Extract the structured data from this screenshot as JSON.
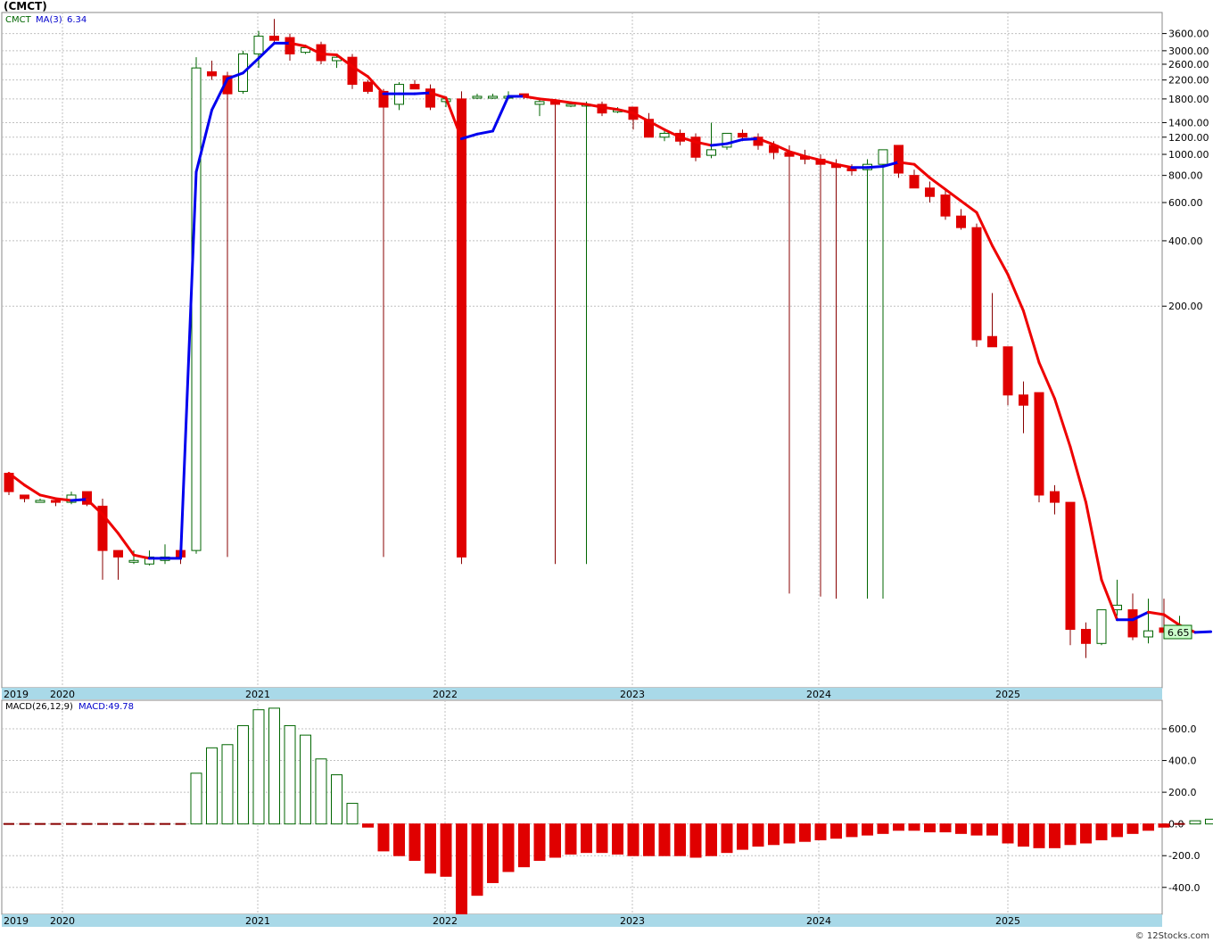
{
  "title": "(CMCT)",
  "credit": "© 12Stocks.com",
  "price_panel": {
    "legend": {
      "symbol": "CMCT",
      "ma_label": "MA(3)",
      "ma_value": "6.34"
    },
    "last_price": "6.65",
    "y_ticks": [
      "3600.00",
      "3000.00",
      "2600.00",
      "2200.00",
      "1800.00",
      "1400.00",
      "1200.00",
      "1000.00",
      "800.00",
      "600.00",
      "400.00",
      "200.00"
    ]
  },
  "macd_panel": {
    "legend": {
      "label": "MACD(26,12,9)",
      "value_label": "MACD:49.78"
    },
    "y_ticks": [
      "600.0",
      "400.0",
      "200.0",
      "0.0",
      "-200.0",
      "-400.0"
    ]
  },
  "x_axis": {
    "labels": [
      "2019",
      "2020",
      "2021",
      "2022",
      "2023",
      "2024",
      "2025"
    ]
  },
  "colors": {
    "up": "#006600",
    "down": "#e00000",
    "ma_up": "#0000ee",
    "ma_down": "#ee0000",
    "grid": "#c0c0c0",
    "axis_band": "#a9d9e8",
    "price_tag_bg": "#ccffcc"
  },
  "chart_data": [
    {
      "type": "candlestick",
      "scale": "log",
      "ylim": [
        3.5,
        4500
      ],
      "series_names": [
        "CMCT",
        "MA(3)"
      ],
      "candles": [
        {
          "o": 34,
          "h": 34,
          "l": 27,
          "c": 28
        },
        {
          "o": 27,
          "h": 27,
          "l": 25,
          "c": 26
        },
        {
          "o": 25,
          "h": 26,
          "l": 25,
          "c": 25.5
        },
        {
          "o": 25.5,
          "h": 26,
          "l": 24,
          "c": 25
        },
        {
          "o": 25,
          "h": 28,
          "l": 24.5,
          "c": 27
        },
        {
          "o": 28,
          "h": 28,
          "l": 24,
          "c": 24.5
        },
        {
          "o": 24,
          "h": 26,
          "l": 11,
          "c": 15
        },
        {
          "o": 15,
          "h": 15,
          "l": 11,
          "c": 14
        },
        {
          "o": 13.5,
          "h": 15,
          "l": 13,
          "c": 13.5
        },
        {
          "o": 13,
          "h": 15,
          "l": 12.8,
          "c": 14
        },
        {
          "o": 13.5,
          "h": 16,
          "l": 13,
          "c": 14
        },
        {
          "o": 15,
          "h": 15,
          "l": 13,
          "c": 14
        },
        {
          "o": 15,
          "h": 2800,
          "l": 14.5,
          "c": 2500
        },
        {
          "o": 2400,
          "h": 2700,
          "l": 2200,
          "c": 2300
        },
        {
          "o": 2300,
          "h": 2400,
          "l": 14,
          "c": 1900
        },
        {
          "o": 1950,
          "h": 3000,
          "l": 1900,
          "c": 2900
        },
        {
          "o": 2900,
          "h": 3700,
          "l": 2500,
          "c": 3500
        },
        {
          "o": 3500,
          "h": 4200,
          "l": 3200,
          "c": 3350
        },
        {
          "o": 3450,
          "h": 3600,
          "l": 2700,
          "c": 2900
        },
        {
          "o": 2950,
          "h": 3200,
          "l": 2900,
          "c": 3100
        },
        {
          "o": 3200,
          "h": 3300,
          "l": 2600,
          "c": 2700
        },
        {
          "o": 2700,
          "h": 2900,
          "l": 2500,
          "c": 2800
        },
        {
          "o": 2800,
          "h": 2900,
          "l": 2000,
          "c": 2100
        },
        {
          "o": 2150,
          "h": 2200,
          "l": 1900,
          "c": 1950
        },
        {
          "o": 1950,
          "h": 2000,
          "l": 14,
          "c": 1650
        },
        {
          "o": 1700,
          "h": 2150,
          "l": 1600,
          "c": 2100
        },
        {
          "o": 2100,
          "h": 2200,
          "l": 2000,
          "c": 2000
        },
        {
          "o": 2000,
          "h": 2100,
          "l": 1600,
          "c": 1650
        },
        {
          "o": 1750,
          "h": 1850,
          "l": 1650,
          "c": 1800
        },
        {
          "o": 1800,
          "h": 1950,
          "l": 13,
          "c": 14
        },
        {
          "o": 1850,
          "h": 1900,
          "l": 1800,
          "c": 1850
        },
        {
          "o": 1850,
          "h": 1900,
          "l": 1800,
          "c": 1850
        },
        {
          "o": 1850,
          "h": 1950,
          "l": 1800,
          "c": 1850
        },
        {
          "o": 1900,
          "h": 1900,
          "l": 1800,
          "c": 1850
        },
        {
          "o": 1700,
          "h": 1800,
          "l": 1500,
          "c": 1750
        },
        {
          "o": 1750,
          "h": 1800,
          "l": 13,
          "c": 1700
        },
        {
          "o": 1700,
          "h": 1750,
          "l": 1650,
          "c": 1700
        },
        {
          "o": 1700,
          "h": 1750,
          "l": 13,
          "c": 1700
        },
        {
          "o": 1700,
          "h": 1750,
          "l": 1500,
          "c": 1550
        },
        {
          "o": 1600,
          "h": 1650,
          "l": 1550,
          "c": 1600
        },
        {
          "o": 1650,
          "h": 1650,
          "l": 1300,
          "c": 1450
        },
        {
          "o": 1450,
          "h": 1550,
          "l": 1200,
          "c": 1200
        },
        {
          "o": 1200,
          "h": 1300,
          "l": 1150,
          "c": 1250
        },
        {
          "o": 1250,
          "h": 1300,
          "l": 1100,
          "c": 1150
        },
        {
          "o": 1200,
          "h": 1250,
          "l": 930,
          "c": 970
        },
        {
          "o": 990,
          "h": 1400,
          "l": 960,
          "c": 1050
        },
        {
          "o": 1080,
          "h": 1250,
          "l": 1050,
          "c": 1250
        },
        {
          "o": 1250,
          "h": 1300,
          "l": 1150,
          "c": 1200
        },
        {
          "o": 1200,
          "h": 1250,
          "l": 1050,
          "c": 1100
        },
        {
          "o": 1100,
          "h": 1150,
          "l": 950,
          "c": 1020
        },
        {
          "o": 1020,
          "h": 1100,
          "l": 9.5,
          "c": 980
        },
        {
          "o": 980,
          "h": 1050,
          "l": 900,
          "c": 950
        },
        {
          "o": 950,
          "h": 1000,
          "l": 9.2,
          "c": 900
        },
        {
          "o": 900,
          "h": 950,
          "l": 9,
          "c": 870
        },
        {
          "o": 860,
          "h": 900,
          "l": 800,
          "c": 840
        },
        {
          "o": 850,
          "h": 950,
          "l": 9,
          "c": 900
        },
        {
          "o": 900,
          "h": 1050,
          "l": 9,
          "c": 1050
        },
        {
          "o": 1100,
          "h": 1100,
          "l": 780,
          "c": 820
        },
        {
          "o": 800,
          "h": 850,
          "l": 700,
          "c": 700
        },
        {
          "o": 700,
          "h": 750,
          "l": 600,
          "c": 640
        },
        {
          "o": 650,
          "h": 680,
          "l": 500,
          "c": 520
        },
        {
          "o": 520,
          "h": 560,
          "l": 450,
          "c": 460
        },
        {
          "o": 460,
          "h": 480,
          "l": 130,
          "c": 140
        },
        {
          "o": 145,
          "h": 230,
          "l": 130,
          "c": 130
        },
        {
          "o": 130,
          "h": 130,
          "l": 70,
          "c": 78
        },
        {
          "o": 78,
          "h": 90,
          "l": 52,
          "c": 70
        },
        {
          "o": 80,
          "h": 80,
          "l": 25,
          "c": 27
        },
        {
          "o": 28,
          "h": 30,
          "l": 22,
          "c": 25
        },
        {
          "o": 25,
          "h": 25,
          "l": 5.5,
          "c": 6.5
        },
        {
          "o": 6.5,
          "h": 7,
          "l": 4.8,
          "c": 5.6
        },
        {
          "o": 5.6,
          "h": 8,
          "l": 5.5,
          "c": 8
        },
        {
          "o": 8,
          "h": 11,
          "l": 7.5,
          "c": 8.4
        },
        {
          "o": 8,
          "h": 9.5,
          "l": 5.8,
          "c": 6
        },
        {
          "o": 6,
          "h": 9,
          "l": 5.6,
          "c": 6.4
        },
        {
          "o": 6.6,
          "h": 9,
          "l": 6.4,
          "c": 6.3
        },
        {
          "o": 6.3,
          "h": 7.5,
          "l": 6.1,
          "c": 6.65
        }
      ],
      "ma": [
        34,
        30,
        27,
        26,
        25.5,
        25.8,
        22,
        18,
        14.3,
        13.8,
        13.8,
        13.8,
        830,
        1600,
        2230,
        2370,
        2770,
        3250,
        3250,
        3150,
        2900,
        2870,
        2540,
        2280,
        1900,
        1900,
        1900,
        1920,
        1820,
        1180,
        1240,
        1280,
        1850,
        1850,
        1800,
        1770,
        1730,
        1700,
        1650,
        1610,
        1550,
        1420,
        1300,
        1200,
        1140,
        1100,
        1120,
        1170,
        1180,
        1110,
        1030,
        980,
        940,
        900,
        870,
        870,
        880,
        920,
        900,
        780,
        690,
        610,
        540,
        380,
        280,
        190,
        110,
        75,
        45,
        25,
        11,
        7.2,
        7.2,
        7.8,
        7.6,
        6.8,
        6.3,
        6.34
      ]
    },
    {
      "type": "bar",
      "series_names": [
        "MACD"
      ],
      "ylim": [
        -570,
        780
      ],
      "values": [
        0,
        0,
        0,
        0,
        0,
        0,
        0,
        0,
        0,
        0,
        0,
        0,
        320,
        480,
        500,
        620,
        720,
        730,
        620,
        560,
        410,
        310,
        130,
        -20,
        -170,
        -200,
        -230,
        -310,
        -330,
        -570,
        -450,
        -370,
        -300,
        -270,
        -230,
        -210,
        -190,
        -180,
        -180,
        -190,
        -200,
        -200,
        -200,
        -200,
        -210,
        -200,
        -180,
        -160,
        -140,
        -130,
        -120,
        -110,
        -100,
        -90,
        -80,
        -70,
        -60,
        -40,
        -40,
        -50,
        -50,
        -60,
        -70,
        -70,
        -120,
        -140,
        -150,
        -150,
        -130,
        -120,
        -100,
        -80,
        -60,
        -40,
        -20,
        0,
        20,
        30,
        40,
        49.78
      ]
    }
  ]
}
